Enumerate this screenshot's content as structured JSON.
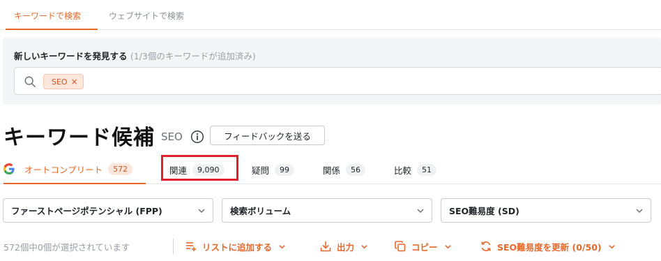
{
  "top_tabs": {
    "keyword_search": "キーワードで検索",
    "website_search": "ウェブサイトで検索"
  },
  "search_panel": {
    "title": "新しいキーワードを発見する",
    "subtitle": "(1/3個のキーワードが追加済み)",
    "chip_label": "SEO",
    "chip_remove": "×"
  },
  "heading": {
    "title": "キーワード候補",
    "keyword": "SEO",
    "feedback_label": "フィードバックを送る"
  },
  "sub_tabs": [
    {
      "label": "オートコンプリート",
      "count": "572"
    },
    {
      "label": "関連",
      "count": "9,090"
    },
    {
      "label": "疑問",
      "count": "99"
    },
    {
      "label": "関係",
      "count": "56"
    },
    {
      "label": "比較",
      "count": "51"
    }
  ],
  "filters": [
    {
      "label": "ファーストページポテンシャル (FPP)"
    },
    {
      "label": "検索ボリューム"
    },
    {
      "label": "SEO難易度 (SD)"
    }
  ],
  "action_bar": {
    "selection_status": "572個中0個が選択されています",
    "add_to_list": "リストに追加する",
    "export": "出力",
    "copy": "コピー",
    "update_sd": "SEO難易度を更新 (0/50)"
  },
  "colors": {
    "accent": "#e8682a",
    "highlight": "#e0202a"
  }
}
